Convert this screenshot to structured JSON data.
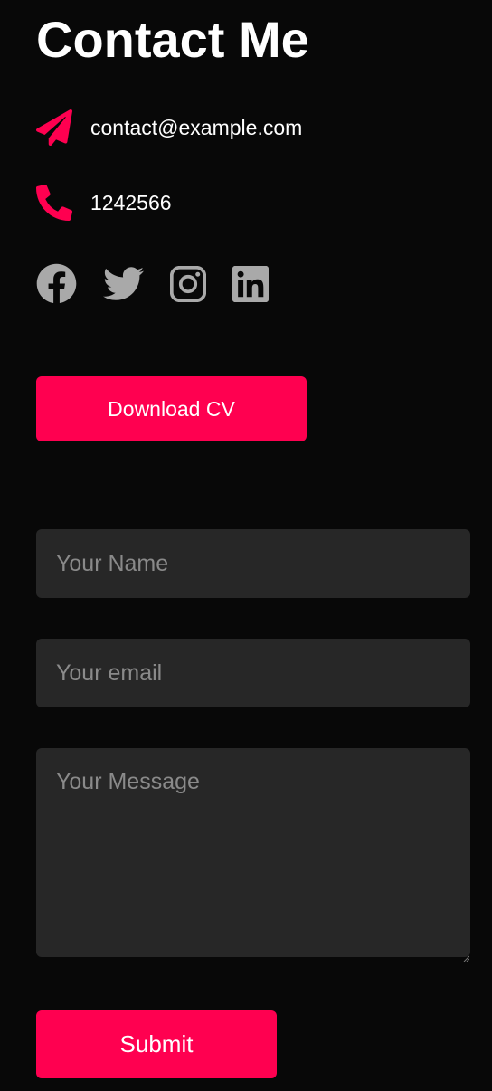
{
  "heading": "Contact Me",
  "contact": {
    "email": "contact@example.com",
    "phone": "1242566"
  },
  "icons": {
    "email": "paper-plane-icon",
    "phone": "phone-icon",
    "social": [
      "facebook-icon",
      "twitter-icon",
      "instagram-icon",
      "linkedin-icon"
    ]
  },
  "colors": {
    "background": "#080808",
    "accent": "#ff0050",
    "field": "#272727",
    "social_icon": "#a9a9a9",
    "placeholder": "#8a8a8a"
  },
  "buttons": {
    "download_cv": "Download CV",
    "submit": "Submit"
  },
  "form": {
    "name_placeholder": "Your Name",
    "email_placeholder": "Your email",
    "message_placeholder": "Your Message"
  }
}
